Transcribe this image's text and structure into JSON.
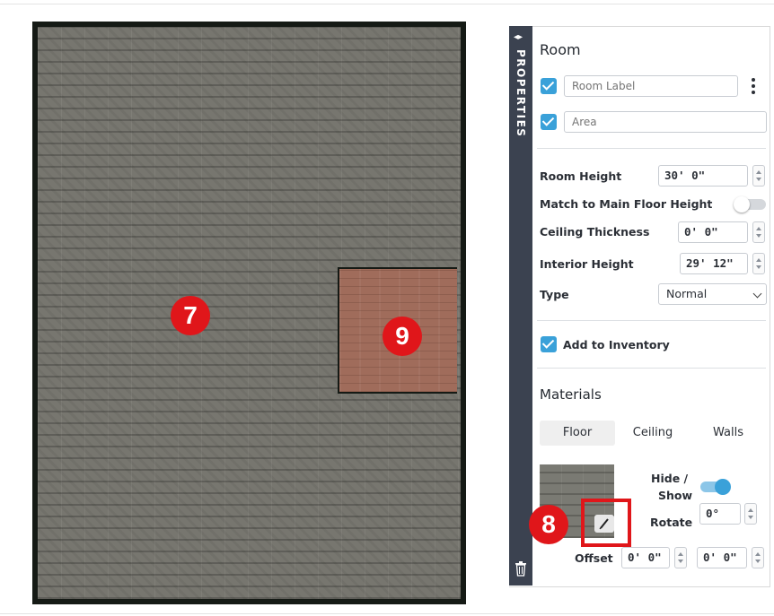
{
  "annotations": {
    "badge_7": "7",
    "badge_8": "8",
    "badge_9": "9"
  },
  "sidebar": {
    "title": "PROPERTIES"
  },
  "room": {
    "title": "Room",
    "room_label_placeholder": "Room Label",
    "area_placeholder": "Area",
    "room_height_label": "Room Height",
    "room_height_value": "30'  0\"",
    "match_label": "Match to Main Floor Height",
    "match_on": false,
    "ceiling_thickness_label": "Ceiling Thickness",
    "ceiling_thickness_value": "0'   0\"",
    "interior_height_label": "Interior Height",
    "interior_height_value": "29'  12\"",
    "type_label": "Type",
    "type_value": "Normal",
    "add_inventory_label": "Add to Inventory"
  },
  "materials": {
    "title": "Materials",
    "tabs": [
      {
        "label": "Floor",
        "active": true
      },
      {
        "label": "Ceiling",
        "active": false
      },
      {
        "label": "Walls",
        "active": false
      }
    ],
    "hide_show_label_1": "Hide /",
    "hide_show_label_2": "Show",
    "hide_show_on": true,
    "rotate_label": "Rotate",
    "rotate_value": "0°",
    "offset_label": "Offset",
    "offset_x": "0'  0\"",
    "offset_y": "0'  0\""
  },
  "colors": {
    "accent": "#3aa1d9",
    "badge": "#e0161a",
    "strip": "#3b4250",
    "floor_gray": "#77766f",
    "floor_wood": "#a06c5b"
  }
}
